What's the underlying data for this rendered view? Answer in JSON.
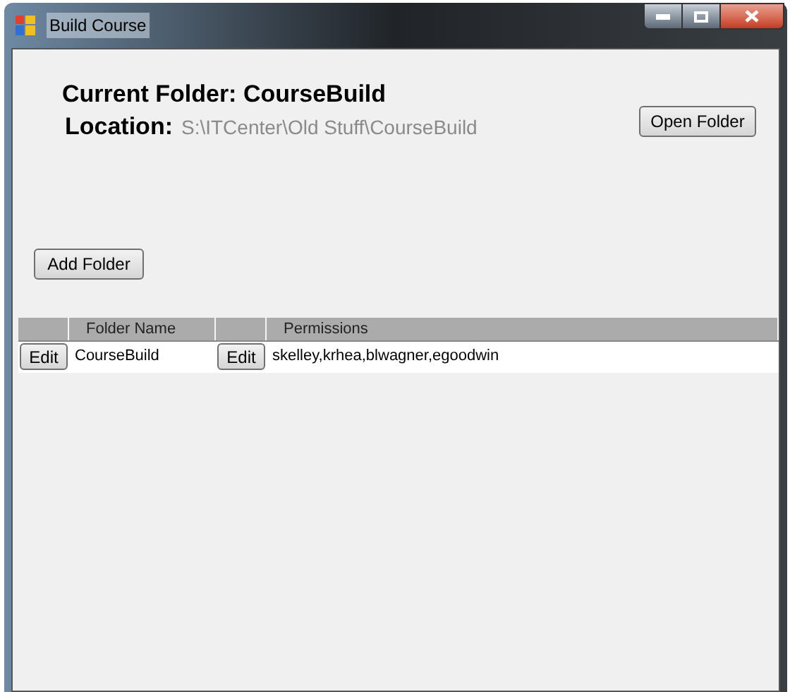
{
  "window": {
    "title": "Build Course"
  },
  "current_folder": {
    "label": "Current Folder:",
    "value": "CourseBuild"
  },
  "location": {
    "label": "Location:",
    "value": "S:\\ITCenter\\Old Stuff\\CourseBuild"
  },
  "buttons": {
    "open_folder": "Open Folder",
    "add_folder": "Add Folder"
  },
  "table": {
    "columns": [
      "",
      "Folder Name",
      "",
      "Permissions"
    ],
    "rows": [
      {
        "edit_name": "Edit",
        "folder_name": "CourseBuild",
        "edit_permissions": "Edit",
        "permissions": "skelley,krhea,blwagner,egoodwin"
      }
    ]
  }
}
